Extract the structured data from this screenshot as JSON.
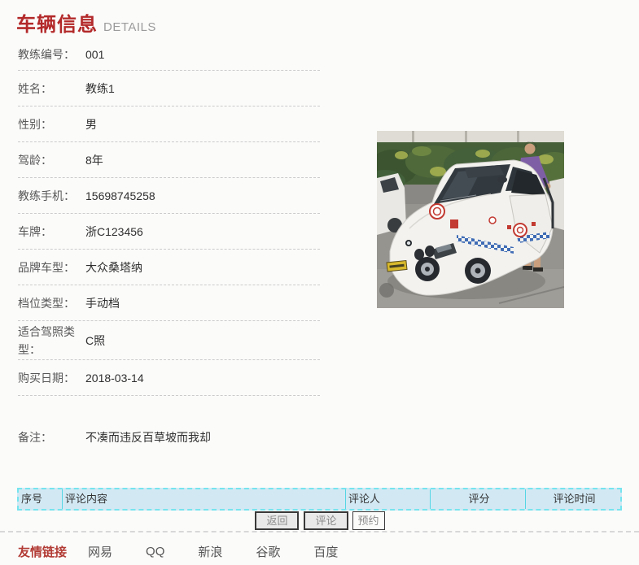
{
  "header": {
    "title": "车辆信息",
    "subtitle": "DETAILS"
  },
  "fields": [
    {
      "label": "教练编号：",
      "value": "001"
    },
    {
      "label": "姓名：",
      "value": "教练1"
    },
    {
      "label": "性别：",
      "value": "男"
    },
    {
      "label": "驾龄：",
      "value": "8年"
    },
    {
      "label": "教练手机：",
      "value": "15698745258"
    },
    {
      "label": "车牌：",
      "value": "浙C123456"
    },
    {
      "label": "品牌车型：",
      "value": "大众桑塔纳"
    },
    {
      "label": "档位类型：",
      "value": "手动档"
    },
    {
      "label": "适合驾照类型：",
      "value": "C照"
    },
    {
      "label": "购买日期：",
      "value": "2018-03-14"
    },
    {
      "label": "备注：",
      "value": "不凑而违反百草坡而我却"
    }
  ],
  "comments_table": {
    "headers": [
      "序号",
      "评论内容",
      "评论人",
      "评分",
      "评论时间"
    ],
    "rows": []
  },
  "actions": {
    "back": "返回",
    "comment": "评论",
    "reserve": "预约"
  },
  "footer": {
    "title": "友情链接",
    "links": [
      "网易",
      "QQ",
      "新浪",
      "谷歌",
      "百度"
    ]
  },
  "colors": {
    "title_red": "#b3292a",
    "table_header_bg": "#d2e9f4",
    "table_border": "#55d6e4",
    "footer_title_red": "#b23b35"
  }
}
